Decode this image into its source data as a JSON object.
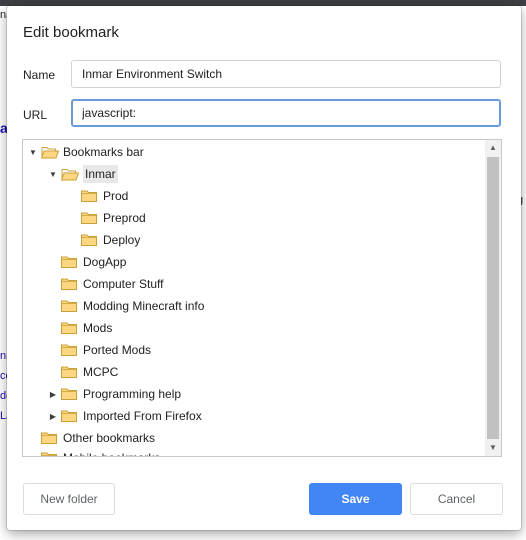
{
  "dialog": {
    "title": "Edit bookmark",
    "name_label": "Name",
    "name_value": "Inmar Environment Switch",
    "url_label": "URL",
    "url_value": "javascript:"
  },
  "tree": {
    "rows": [
      {
        "label": "Bookmarks bar",
        "expanded": true
      },
      {
        "label": "Inmar",
        "expanded": true,
        "selected": true
      },
      {
        "label": "Prod"
      },
      {
        "label": "Preprod"
      },
      {
        "label": "Deploy"
      },
      {
        "label": "DogApp"
      },
      {
        "label": "Computer Stuff"
      },
      {
        "label": "Modding Minecraft info"
      },
      {
        "label": "Mods"
      },
      {
        "label": "Ported Mods"
      },
      {
        "label": "MCPC"
      },
      {
        "label": "Programming help",
        "expanded": false
      },
      {
        "label": "Imported From Firefox",
        "expanded": false
      },
      {
        "label": "Other bookmarks"
      },
      {
        "label": "Mobile bookmarks"
      }
    ]
  },
  "buttons": {
    "new_folder": "New folder",
    "save": "Save",
    "cancel": "Cancel"
  },
  "colors": {
    "primary": "#4285f4",
    "folder_fill": "#fcd681",
    "folder_stroke": "#c9a13b",
    "focus_border": "#6b9bd6"
  },
  "icons": {
    "folder": "folder-icon",
    "expanded": "triangle-down-icon",
    "collapsed": "triangle-right-icon"
  },
  "background_fragments": [
    "na",
    "a",
    "g",
    "nn",
    "ce",
    "de",
    "La"
  ]
}
